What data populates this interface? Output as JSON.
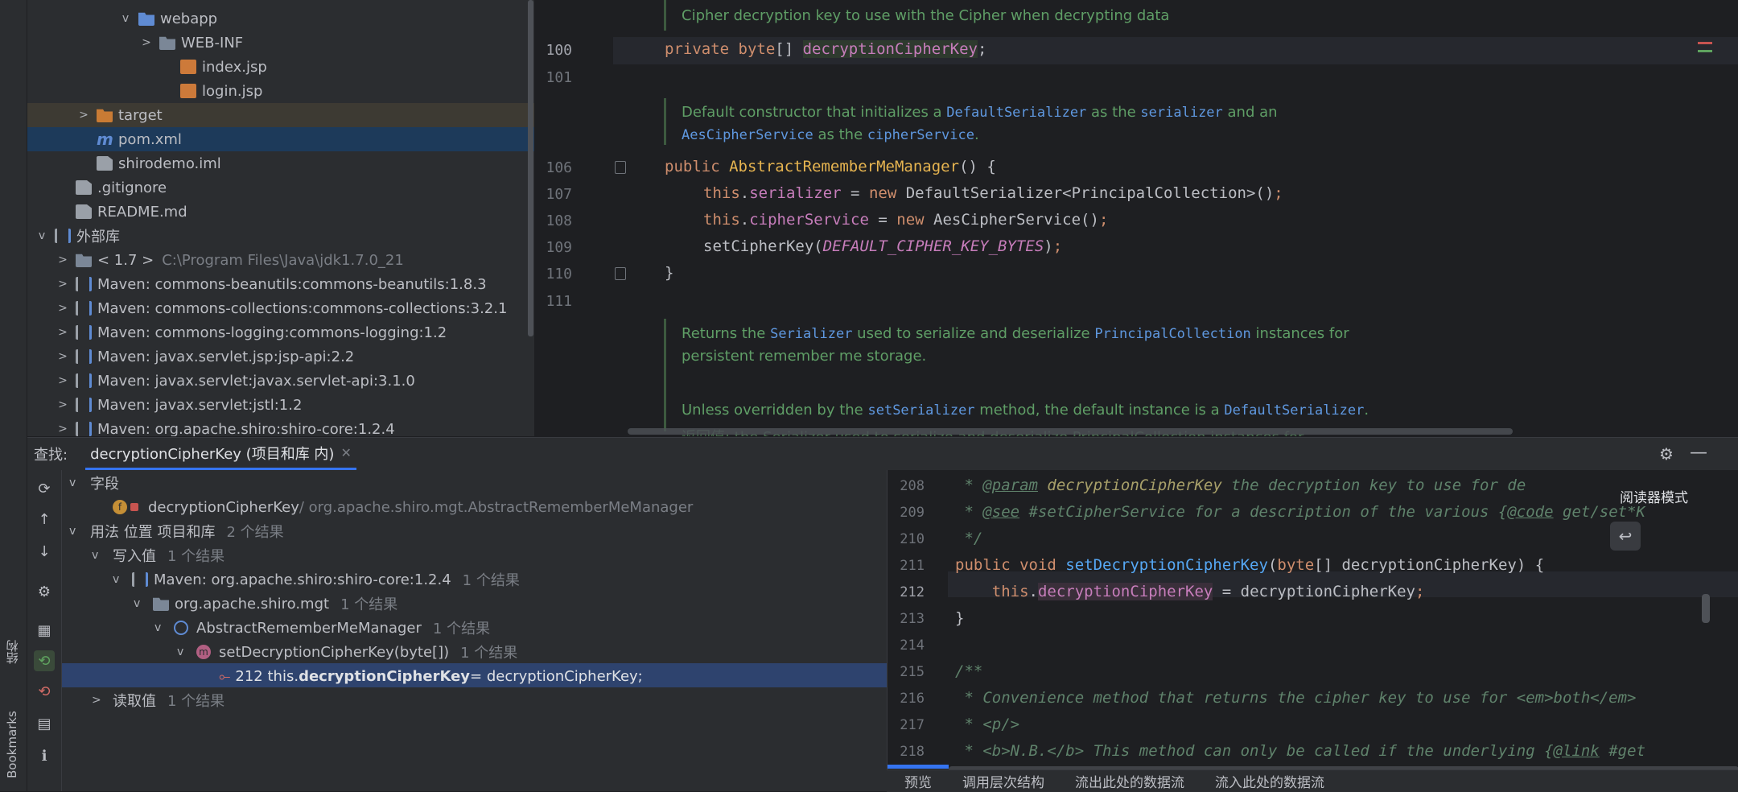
{
  "left_strip": {
    "structure_label": "结构",
    "bookmarks_label": "Bookmarks"
  },
  "project_tree": {
    "items": [
      {
        "label": "webapp",
        "indent": 4,
        "arrow": "v",
        "icon": "folder-web"
      },
      {
        "label": "WEB-INF",
        "indent": 5,
        "arrow": ">",
        "icon": "folder"
      },
      {
        "label": "index.jsp",
        "indent": 6,
        "arrow": "",
        "icon": "jsp"
      },
      {
        "label": "login.jsp",
        "indent": 6,
        "arrow": "",
        "icon": "jsp"
      },
      {
        "label": "target",
        "indent": 2,
        "arrow": ">",
        "icon": "folder-orange"
      },
      {
        "label": "pom.xml",
        "indent": 2,
        "arrow": "",
        "icon": "maven"
      },
      {
        "label": "shirodemo.iml",
        "indent": 2,
        "arrow": "",
        "icon": "file"
      },
      {
        "label": ".gitignore",
        "indent": 1,
        "arrow": "",
        "icon": "file"
      },
      {
        "label": "README.md",
        "indent": 1,
        "arrow": "",
        "icon": "file"
      },
      {
        "label": "外部库",
        "indent": 0,
        "arrow": "v",
        "icon": "lib"
      },
      {
        "label": "< 1.7 >",
        "extra": "C:\\Program Files\\Java\\jdk1.7.0_21",
        "indent": 1,
        "arrow": ">",
        "icon": "folder"
      },
      {
        "label": "Maven: commons-beanutils:commons-beanutils:1.8.3",
        "indent": 1,
        "arrow": ">",
        "icon": "lib"
      },
      {
        "label": "Maven: commons-collections:commons-collections:3.2.1",
        "indent": 1,
        "arrow": ">",
        "icon": "lib"
      },
      {
        "label": "Maven: commons-logging:commons-logging:1.2",
        "indent": 1,
        "arrow": ">",
        "icon": "lib"
      },
      {
        "label": "Maven: javax.servlet.jsp:jsp-api:2.2",
        "indent": 1,
        "arrow": ">",
        "icon": "lib"
      },
      {
        "label": "Maven: javax.servlet:javax.servlet-api:3.1.0",
        "indent": 1,
        "arrow": ">",
        "icon": "lib"
      },
      {
        "label": "Maven: javax.servlet:jstl:1.2",
        "indent": 1,
        "arrow": ">",
        "icon": "lib"
      },
      {
        "label": "Maven: org.apache.shiro:shiro-core:1.2.4",
        "indent": 1,
        "arrow": ">",
        "icon": "lib"
      }
    ]
  },
  "editor": {
    "doc1": "Cipher decryption key to use with the Cipher when decrypting data",
    "line100_num": "100",
    "line100": "private byte[] decryptionCipherKey;",
    "line101_num": "101",
    "doc2a": "Default constructor that initializes a ",
    "doc2b": "DefaultSerializer",
    "doc2c": " as the ",
    "doc2d": "serializer",
    "doc2e": " and an",
    "doc2f": "AesCipherService",
    "doc2g": " as the ",
    "doc2h": "cipherService",
    "doc2i": ".",
    "l106": "106",
    "l107": "107",
    "l108": "108",
    "l109": "109",
    "l110": "110",
    "l111": "111",
    "doc3a": "Returns the ",
    "doc3b": "Serializer",
    "doc3c": " used to serialize and deserialize ",
    "doc3d": "PrincipalCollection",
    "doc3e": " instances for",
    "doc3f": "persistent remember me storage.",
    "doc4a": "Unless overridden by the ",
    "doc4b": "setSerializer",
    "doc4c": " method, the default instance is a ",
    "doc4d": "DefaultSerializer",
    "doc4e": ".",
    "doc5": "返回值: the Serializer used to serialize and deserialize PrincipalCollection instances for"
  },
  "find": {
    "label": "查找:",
    "tab_title": "decryptionCipherKey (项目和库 内)",
    "fields_label": "字段",
    "field_name": "decryptionCipherKey",
    "field_path": " / org.apache.shiro.mgt.AbstractRememberMeManager",
    "usages_label": "用法 位置 项目和库",
    "usages_count": "2 个结果",
    "write_label": "写入值",
    "write_count": "1 个结果",
    "maven_label": "Maven: org.apache.shiro:shiro-core:1.2.4",
    "maven_count": "1 个结果",
    "pkg_label": "org.apache.shiro.mgt",
    "pkg_count": "1 个结果",
    "class_label": "AbstractRememberMeManager",
    "class_count": "1 个结果",
    "method_label": "setDecryptionCipherKey(byte[])",
    "method_count": "1 个结果",
    "hit_line": "212 this.",
    "hit_bold": "decryptionCipherKey",
    "hit_rest": " = decryptionCipherKey;",
    "read_label": "读取值",
    "read_count": "1 个结果"
  },
  "preview": {
    "reader_mode": "阅读器模式",
    "lines": [
      {
        "n": "208"
      },
      {
        "n": "209"
      },
      {
        "n": "210"
      },
      {
        "n": "211"
      },
      {
        "n": "212"
      },
      {
        "n": "213"
      },
      {
        "n": "214"
      },
      {
        "n": "215"
      },
      {
        "n": "216"
      },
      {
        "n": "217"
      },
      {
        "n": "218"
      }
    ],
    "tabs": [
      "预览",
      "调用层次结构",
      "流出此处的数据流",
      "流入此处的数据流"
    ]
  }
}
